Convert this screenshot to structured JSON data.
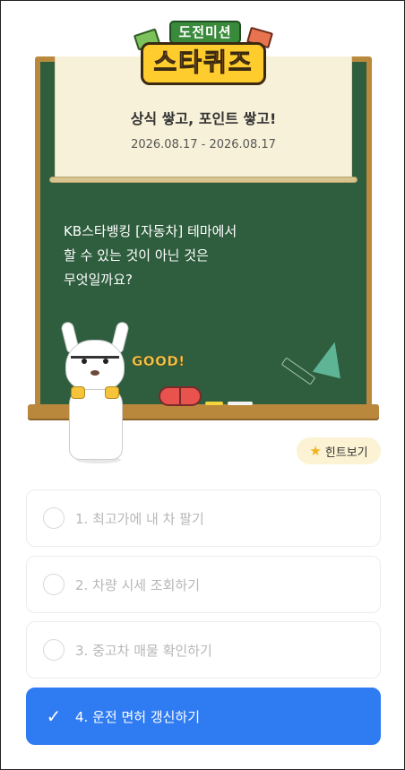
{
  "header": {
    "logo_top": "도전미션",
    "logo_main": "스타퀴즈"
  },
  "board": {
    "title": "상식 쌓고, 포인트 쌓고!",
    "date_range": "2026.08.17 - 2026.08.17",
    "question_lines": [
      "KB스타뱅킹 [자동차] 테마에서",
      "할 수 있는 것이 아닌 것은",
      "무엇일까요?"
    ],
    "good_text": "GOOD!"
  },
  "hint": {
    "icon": "star-icon",
    "label": "힌트보기"
  },
  "options": [
    {
      "label": "1. 최고가에 내 차 팔기",
      "selected": false
    },
    {
      "label": "2. 차량 시세 조회하기",
      "selected": false
    },
    {
      "label": "3. 중고차 매물 확인하기",
      "selected": false
    },
    {
      "label": "4. 운전 면허 갱신하기",
      "selected": true
    }
  ],
  "colors": {
    "board": "#2f5e3e",
    "frame": "#b98a3e",
    "selected": "#2f7bf2",
    "hint_bg": "#fbf3d3"
  }
}
